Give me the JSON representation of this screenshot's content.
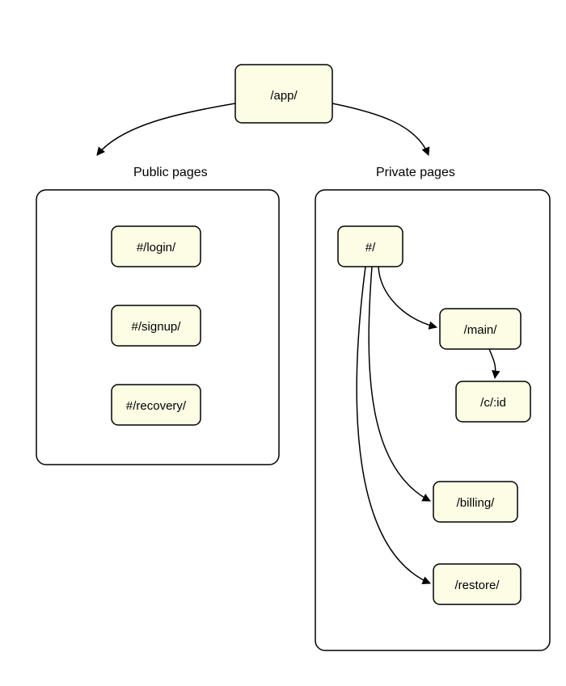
{
  "root": {
    "label": "/app/"
  },
  "sections": {
    "public": {
      "title": "Public pages",
      "items": [
        {
          "label": "#/login/"
        },
        {
          "label": "#/signup/"
        },
        {
          "label": "#/recovery/"
        }
      ]
    },
    "private": {
      "title": "Private pages",
      "root": {
        "label": "#/"
      },
      "children": [
        {
          "label": "/main/",
          "children": [
            {
              "label": "/c/:id"
            }
          ]
        },
        {
          "label": "/billing/"
        },
        {
          "label": "/restore/"
        }
      ]
    }
  }
}
